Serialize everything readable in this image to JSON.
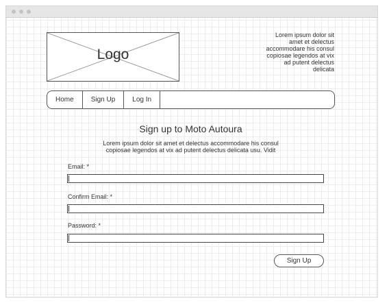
{
  "header": {
    "logo_text": "Logo",
    "copy_lines": [
      "Lorem ipsum dolor sit",
      "amet et delectus",
      "accommodare his consul",
      "copiosae legendos at vix",
      "ad putent delectus",
      "delicata"
    ]
  },
  "nav": {
    "items": [
      {
        "label": "Home"
      },
      {
        "label": "Sign Up"
      },
      {
        "label": "Log In"
      }
    ]
  },
  "form": {
    "title": "Sign up to Moto Autoura",
    "description_lines": [
      "Lorem ipsum dolor sit amet et delectus accommodare his consul",
      "copiosae legendos at vix ad putent delectus delicata usu. Vidit"
    ],
    "fields": [
      {
        "label": "Email: *",
        "value": ""
      },
      {
        "label": "Confirm Email: *",
        "value": ""
      },
      {
        "label": "Password: *",
        "value": ""
      }
    ],
    "submit_label": "Sign Up"
  }
}
